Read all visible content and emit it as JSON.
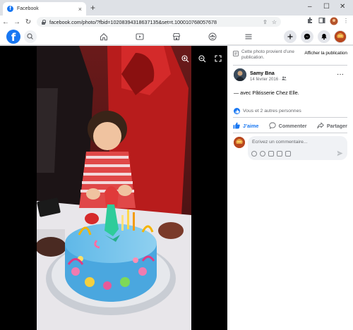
{
  "browser": {
    "tab_title": "Facebook",
    "tab_close": "×",
    "new_tab": "+",
    "url": "facebook.com/photo/?fbid=10208394318637135&set=t.100010768057678",
    "window_controls": {
      "minimize": "–",
      "maximize": "☐",
      "close": "✕"
    }
  },
  "fb": {
    "logo_letter": "f"
  },
  "post": {
    "notice_text": "Cette photo provient d’une publication.",
    "notice_link": "Afficher la publication",
    "author": "Samy Bna",
    "date": "14 février 2016 ·",
    "caption_prefix": "— avec ",
    "caption_page": "Pâtisserie Chez Elle",
    "caption_suffix": ".",
    "reactions_text": "Vous et 2 autres personnes",
    "like_label": "J’aime",
    "comment_label": "Commenter",
    "share_label": "Partager",
    "comment_placeholder": "Écrivez un commentaire..."
  },
  "colors": {
    "fb_blue": "#1877f2",
    "secondary_text": "#65676b",
    "viewer_bg": "#000000"
  },
  "icons": [
    "search-icon",
    "home-icon",
    "video-icon",
    "marketplace-icon",
    "groups-icon",
    "menu-icon",
    "create-icon",
    "messenger-icon",
    "notifications-icon",
    "zoom-in-icon",
    "zoom-out-icon",
    "fullscreen-icon",
    "like-icon",
    "comment-icon",
    "share-icon",
    "send-icon"
  ]
}
